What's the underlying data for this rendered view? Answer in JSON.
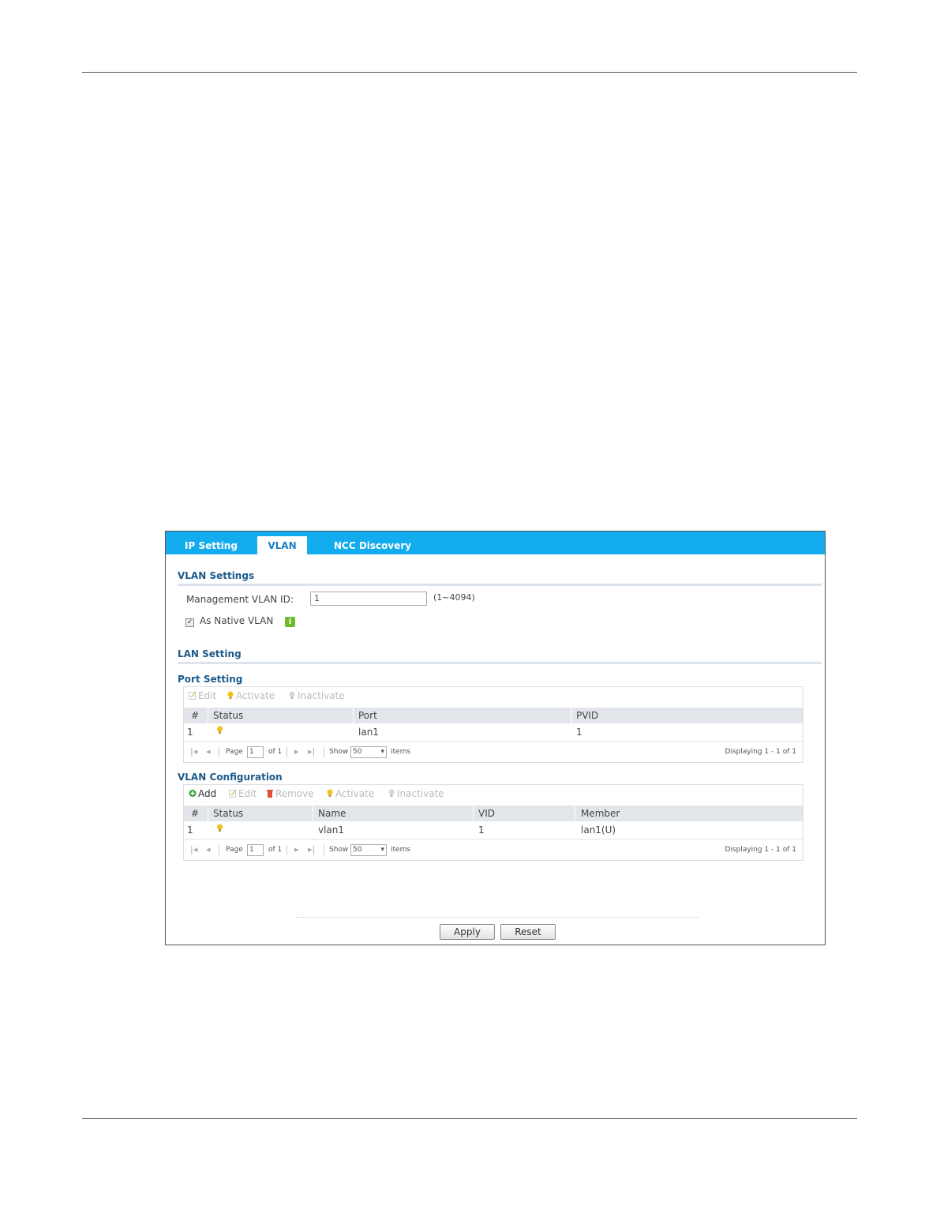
{
  "tabs": [
    {
      "label": "IP Setting",
      "active": false
    },
    {
      "label": "VLAN",
      "active": true
    },
    {
      "label": "NCC Discovery",
      "active": false
    }
  ],
  "vlan_settings": {
    "title": "VLAN Settings",
    "mgmt_vlan_label": "Management VLAN ID:",
    "mgmt_vlan_value": "1",
    "mgmt_vlan_range": "(1~4094)",
    "native_vlan_label": "As Native VLAN",
    "native_vlan_checked": true
  },
  "lan_setting": {
    "title": "LAN Setting"
  },
  "port_setting": {
    "title": "Port Setting",
    "toolbar": {
      "edit": "Edit",
      "activate": "Activate",
      "inactivate": "Inactivate"
    },
    "columns": [
      "#",
      "Status",
      "Port",
      "PVID"
    ],
    "rows": [
      {
        "num": "1",
        "status": "active",
        "port": "lan1",
        "pvid": "1"
      }
    ],
    "pager": {
      "page_label": "Page",
      "page_value": "1",
      "of_label": "of 1",
      "show_label": "Show",
      "show_value": "50",
      "items_label": "items",
      "displaying": "Displaying 1 - 1 of 1"
    }
  },
  "vlan_configuration": {
    "title": "VLAN Configuration",
    "toolbar": {
      "add": "Add",
      "edit": "Edit",
      "remove": "Remove",
      "activate": "Activate",
      "inactivate": "Inactivate"
    },
    "columns": [
      "#",
      "Status",
      "Name",
      "VID",
      "Member"
    ],
    "rows": [
      {
        "num": "1",
        "status": "active",
        "name": "vlan1",
        "vid": "1",
        "member": "lan1(U)"
      }
    ],
    "pager": {
      "page_label": "Page",
      "page_value": "1",
      "of_label": "of 1",
      "show_label": "Show",
      "show_value": "50",
      "items_label": "items",
      "displaying": "Displaying 1 - 1 of 1"
    }
  },
  "buttons": {
    "apply": "Apply",
    "reset": "Reset"
  },
  "colors": {
    "tab_bar": "#12acef",
    "section_title": "#1c5a8a",
    "header_bg": "#e2e6ea",
    "bulb": "#f2c21b",
    "add_icon": "#3aa53a",
    "remove_icon": "#e0503a",
    "info_icon": "#6dbb2a"
  }
}
